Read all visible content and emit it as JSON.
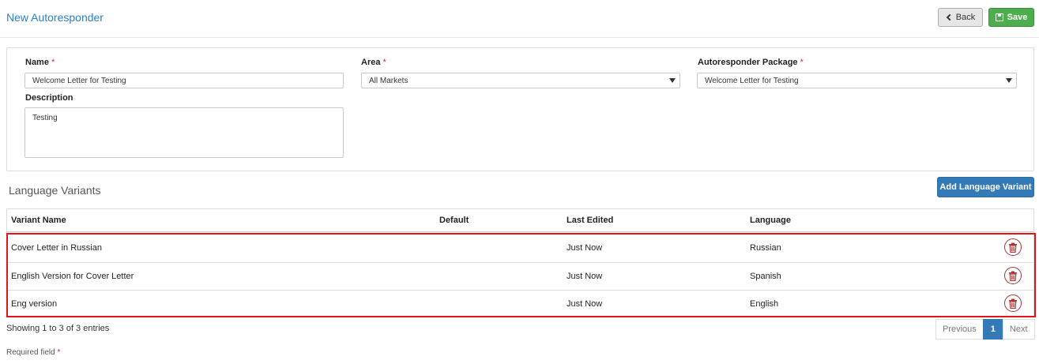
{
  "header": {
    "title": "New Autoresponder",
    "back_label": "Back",
    "save_label": "Save"
  },
  "form": {
    "name_label": "Name",
    "name_value": "Welcome Letter for Testing",
    "area_label": "Area",
    "area_value": "All Markets",
    "package_label": "Autoresponder Package",
    "package_value": "Welcome Letter for Testing",
    "description_label": "Description",
    "description_value": "Testing",
    "required_marker": "*"
  },
  "variants": {
    "title": "Language Variants",
    "add_label": "Add Language Variant",
    "columns": [
      "Variant Name",
      "Default",
      "Last Edited",
      "Language"
    ],
    "rows": [
      {
        "name": "Cover Letter in Russian",
        "default": "",
        "last_edited": "Just Now",
        "language": "Russian"
      },
      {
        "name": "English Version for Cover Letter",
        "default": "",
        "last_edited": "Just Now",
        "language": "Spanish"
      },
      {
        "name": "Eng version",
        "default": "",
        "last_edited": "Just Now",
        "language": "English"
      }
    ],
    "showing_text": "Showing 1 to 3 of 3 entries",
    "pagination": {
      "previous": "Previous",
      "current": "1",
      "next": "Next"
    }
  },
  "footer": {
    "required_note": "Required field",
    "required_marker": "*"
  },
  "colors": {
    "link_blue": "#2a7fc9",
    "primary": "#337ab7",
    "success": "#4cae4c",
    "danger": "#e0151b",
    "delete_icon": "#a33"
  },
  "icons": {
    "back": "chevron-left-icon",
    "save": "floppy-disk-icon",
    "select": "caret-down-icon",
    "delete": "trash-icon"
  }
}
